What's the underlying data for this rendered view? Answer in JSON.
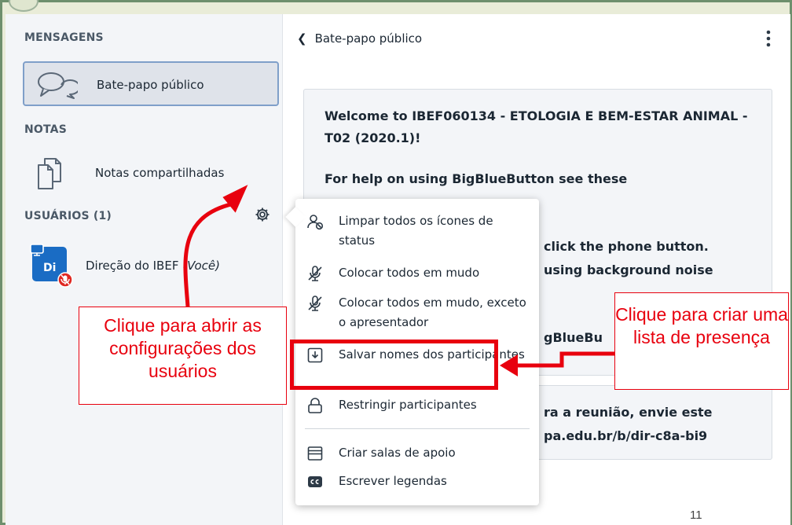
{
  "sidebar": {
    "messages_title": "MENSAGENS",
    "public_chat_label": "Bate-papo público",
    "notes_title": "NOTAS",
    "shared_notes_label": "Notas compartilhadas",
    "users_title": "USUÁRIOS (1)",
    "user": {
      "initials": "Di",
      "name": "Direção do IBEF",
      "you_tag": "(Você)"
    }
  },
  "chat": {
    "header_title": "Bate-papo público",
    "welcome_line1": "Welcome to IBEF060134 - ETOLOGIA E BEM-ESTAR ANIMAL - T02 (2020.1)!",
    "help_line": "For help on using BigBlueButton see these",
    "fragment_phone": "click the phone button.",
    "fragment_noise": "using background noise",
    "fragment_bbb": "gBlueBu",
    "invite_line1": "ra a reunião, envie este",
    "invite_line2": "pa.edu.br/b/dir-c8a-bi9"
  },
  "menu": {
    "items": [
      {
        "icon": "clear-status-icon",
        "label": "Limpar todos os ícones de status"
      },
      {
        "icon": "mute-icon",
        "label": "Colocar todos em mudo"
      },
      {
        "icon": "mute-except-presenter-icon",
        "label": "Colocar todos em mudo, exceto o apresentador"
      },
      {
        "icon": "download-icon",
        "label": "Salvar nomes dos participantes"
      },
      {
        "icon": "lock-icon",
        "label": "Restringir participantes"
      },
      {
        "icon": "breakout-rooms-icon",
        "label": "Criar salas de apoio"
      },
      {
        "icon": "closed-captions-icon",
        "label": "Escrever legendas"
      }
    ]
  },
  "annotations": {
    "left_callout": "Clique para abrir as configurações dos usuários",
    "right_callout": "Clique para criar uma lista de presença",
    "color": "#e8000e"
  },
  "page_number": "11",
  "colors": {
    "accent_blue": "#1a6cc4",
    "selected_border": "#7f9fc9",
    "annotation_red": "#e8000e",
    "slide_background": "#e9ecd8"
  }
}
